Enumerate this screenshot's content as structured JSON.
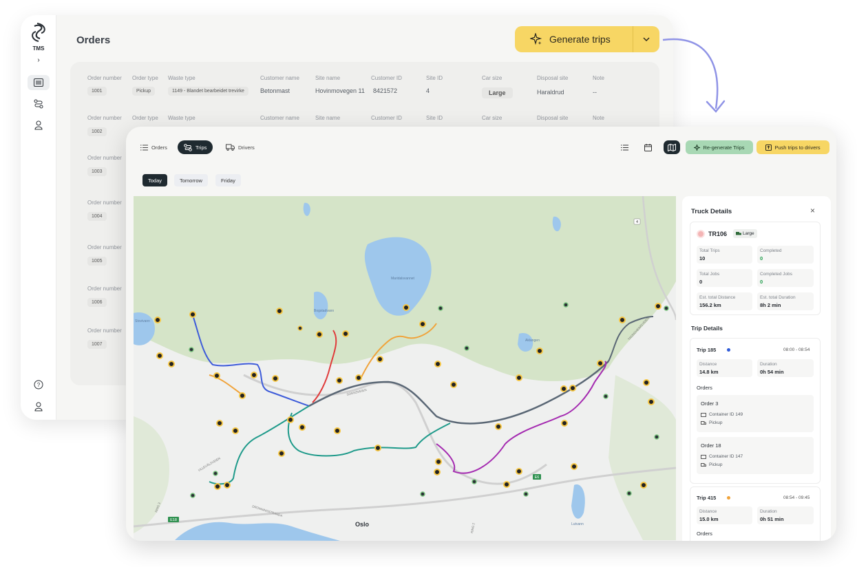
{
  "back": {
    "brand": "TMS",
    "title": "Orders",
    "generate_label": "Generate trips",
    "headers": [
      "Order number",
      "Order type",
      "Waste type",
      "Customer name",
      "Site name",
      "Customer ID",
      "Site ID",
      "Car size",
      "Disposal site",
      "Note"
    ],
    "first_row": {
      "order": "1001",
      "type": "Pickup",
      "waste": "1149 - Blandet bearbeidet trevirke",
      "customer": "Betonmast",
      "site": "Hovinmovegen 11",
      "customer_id": "8421572",
      "site_id": "4",
      "car": "Large",
      "disposal": "Haraldrud",
      "note": "--"
    },
    "order_numbers": [
      "1002",
      "1003",
      "1004",
      "1005",
      "1006",
      "1007"
    ]
  },
  "front": {
    "tabs": [
      {
        "label": "Orders",
        "icon": "list-icon"
      },
      {
        "label": "Trips",
        "icon": "route-icon"
      },
      {
        "label": "Drivers",
        "icon": "truck-icon"
      }
    ],
    "regen_label": "Re-generate Trips",
    "push_label": "Push trips to drivers",
    "days": [
      "Today",
      "Tomorrow",
      "Friday"
    ],
    "map_labels": {
      "city": "Oslo",
      "lake1": "Maridalsvannet",
      "lake2": "Bogstadvann",
      "lake3": "Stovivann",
      "lake4": "Aklangen",
      "lake5": "Lutvann",
      "road_e18": "E18",
      "road_e6": "E6",
      "road_4": "4",
      "road_ring3": "RING 3",
      "road_ring2": "RING 2",
      "road_trond": "TRONDHEIMSVEIEN",
      "road_ulls": "ULLEVÅLSVEIEN",
      "road_sogn": "SOGNSVEIEN",
      "road_drammen": "DRONNINGSTRANDA"
    },
    "panel": {
      "title": "Truck Details",
      "truck_id": "TR106",
      "size": "Large",
      "stats": [
        {
          "label": "Total Trips",
          "value": "10",
          "green": false
        },
        {
          "label": "Completed",
          "value": "0",
          "green": true
        },
        {
          "label": "Total Jobs",
          "value": "0",
          "green": false
        },
        {
          "label": "Completed Jobs",
          "value": "0",
          "green": true
        },
        {
          "label": "Est. total Distance",
          "value": "156.2 km",
          "green": false
        },
        {
          "label": "Est. total Duration",
          "value": "8h 2 min",
          "green": false
        }
      ],
      "trip_details_title": "Trip Details",
      "trips": [
        {
          "name": "Trip 185",
          "dot": "#2f5bd8",
          "time": "08:00 - 08:54",
          "distance_label": "Distance",
          "distance": "14.8 km",
          "duration_label": "Duration",
          "duration": "0h 54 min",
          "orders_title": "Orders",
          "orders": [
            {
              "name": "Order 3",
              "container": "Container ID 149",
              "type": "Pickup"
            },
            {
              "name": "Order 18",
              "container": "Container ID 147",
              "type": "Pickup"
            }
          ]
        },
        {
          "name": "Trip 415",
          "dot": "#f0a33a",
          "time": "08:54 - 09:45",
          "distance_label": "Distance",
          "distance": "15.0 km",
          "duration_label": "Duration",
          "duration": "0h 51 min",
          "orders_title": "Orders"
        }
      ]
    }
  },
  "colors": {
    "yellow": "#f7d664",
    "green_btn": "#a8d8b4",
    "dark": "#1f2a30",
    "route_blue": "#3d5bd9",
    "route_red": "#e03b3b",
    "route_orange": "#f0a33a",
    "route_teal": "#1e9a8a",
    "route_purple": "#a42ab0",
    "route_slate": "#5a6775",
    "water": "#9ec7ec",
    "forest": "#d3e2c7"
  }
}
